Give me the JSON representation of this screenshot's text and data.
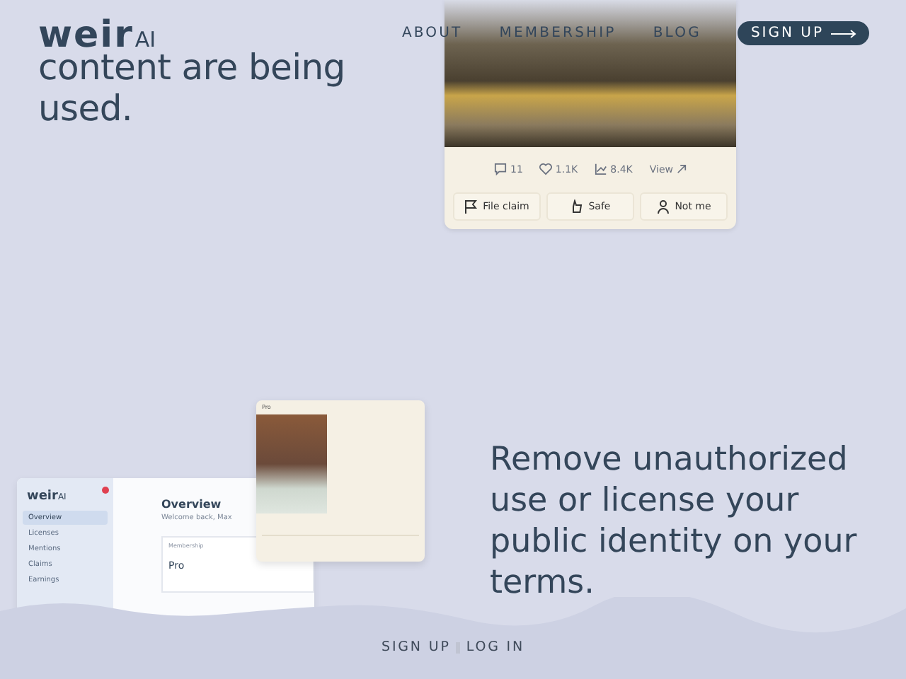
{
  "header": {
    "logo": {
      "word": "weir",
      "suffix": "AI"
    },
    "nav": [
      {
        "label": "ABOUT",
        "kind": "link"
      },
      {
        "label": "MEMBERSHIP",
        "kind": "link"
      },
      {
        "label": "BLOG",
        "kind": "link"
      },
      {
        "label": "SIGN UP",
        "kind": "cta"
      }
    ]
  },
  "intro": {
    "heading": "content are being used."
  },
  "content_card": {
    "stats": [
      {
        "kind": "comments",
        "value": "11"
      },
      {
        "kind": "likes",
        "value": "1.1K"
      },
      {
        "kind": "views",
        "value": "8.4K"
      },
      {
        "kind": "link",
        "value": "View"
      }
    ],
    "actions": [
      {
        "kind": "flag",
        "label": "File claim"
      },
      {
        "kind": "hand",
        "label": "Safe"
      },
      {
        "kind": "person",
        "label": "Not me"
      }
    ]
  },
  "dashboard": {
    "logo": {
      "word": "weir",
      "suffix": "AI"
    },
    "sidebar": [
      {
        "label": "Overview",
        "selected": true
      },
      {
        "label": "Licenses",
        "selected": false
      },
      {
        "label": "Mentions",
        "selected": false
      },
      {
        "label": "Claims",
        "selected": false
      },
      {
        "label": "Earnings",
        "selected": false
      }
    ],
    "title": "Overview",
    "subtitle": "Welcome back, Max",
    "membership": {
      "label": "Membership",
      "plan": "Pro"
    }
  },
  "profile_card": {
    "plan": "Pro"
  },
  "feature": {
    "text": "Remove unauthorized use or license your public identity on your terms."
  },
  "footer": {
    "links": [
      "SIGN UP",
      "LOG IN"
    ]
  }
}
